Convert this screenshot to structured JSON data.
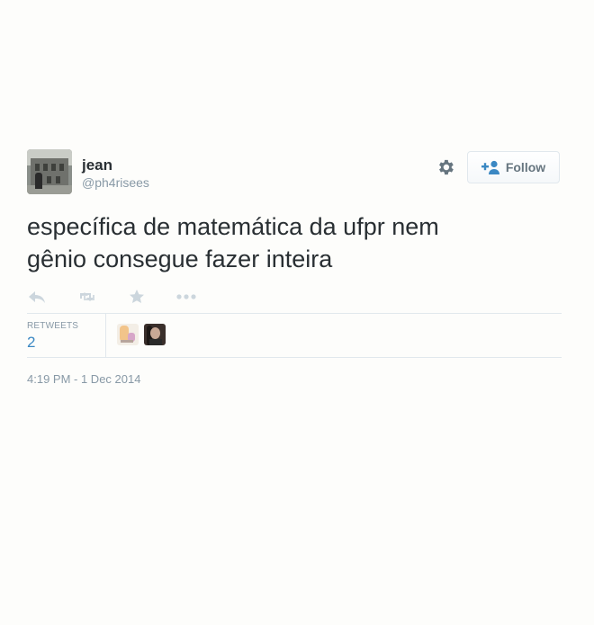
{
  "user": {
    "display_name": "jean",
    "screen_name": "@ph4risees",
    "avatar_icon": "user-avatar"
  },
  "header": {
    "gear_icon": "gear-icon",
    "follow_label": "Follow"
  },
  "tweet": {
    "text_line1": "específica de matemática da ufpr nem",
    "text_line2": "gênio consegue fazer inteira",
    "timestamp": "4:19 PM - 1 Dec 2014"
  },
  "actions": {
    "icons": [
      "reply-icon",
      "retweet-icon",
      "favorite-icon",
      "more-icon"
    ]
  },
  "stats": {
    "retweets_label": "RETWEETS",
    "retweets_count": "2"
  },
  "colors": {
    "text": "#292f33",
    "muted": "#8899a6",
    "link": "#3b88c3",
    "border": "#e1e8ed"
  }
}
